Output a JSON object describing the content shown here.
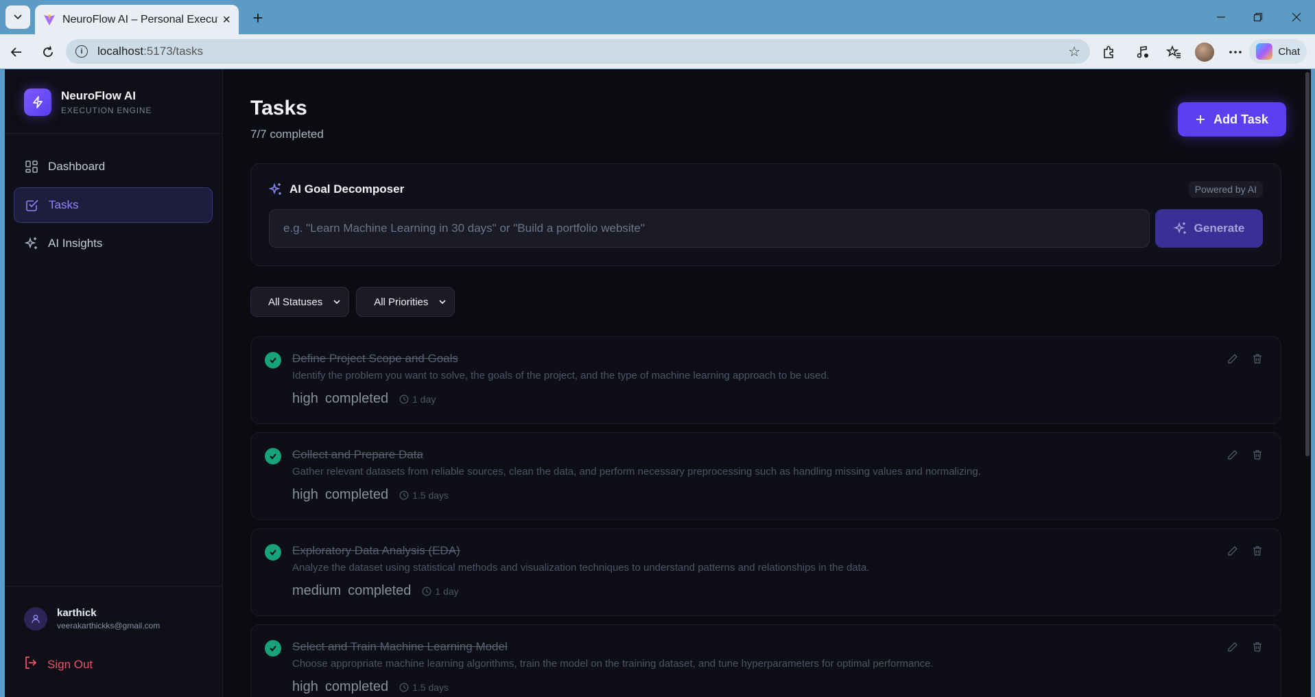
{
  "browser": {
    "tab_title": "NeuroFlow AI – Personal Execution Engine",
    "url_host": "localhost",
    "url_path": ":5173/tasks",
    "chat_label": "Chat"
  },
  "colors": {
    "accent": "#5b3ff0",
    "success": "#16a37a",
    "danger": "#f0506a",
    "background": "#0b0c12"
  },
  "brand": {
    "name": "NeuroFlow AI",
    "subtitle": "EXECUTION ENGINE"
  },
  "sidebar": {
    "items": [
      {
        "label": "Dashboard",
        "icon": "grid-icon"
      },
      {
        "label": "Tasks",
        "icon": "checkbox-icon",
        "active": true
      },
      {
        "label": "AI Insights",
        "icon": "sparkles-icon"
      }
    ]
  },
  "user": {
    "name": "karthick",
    "email": "veerakarthickks@gmail.com",
    "signout_label": "Sign Out"
  },
  "header": {
    "title": "Tasks",
    "subtitle": "7/7 completed",
    "add_task_label": "Add Task"
  },
  "ai_decomposer": {
    "title": "AI Goal Decomposer",
    "badge": "Powered by AI",
    "placeholder": "e.g. \"Learn Machine Learning in 30 days\" or \"Build a portfolio website\"",
    "generate_label": "Generate"
  },
  "filters": {
    "status": "All Statuses",
    "priority": "All Priorities"
  },
  "tasks": [
    {
      "title": "Define Project Scope and Goals",
      "description": "Identify the problem you want to solve, the goals of the project, and the type of machine learning approach to be used.",
      "priority": "high",
      "status": "completed",
      "duration": "1 day"
    },
    {
      "title": "Collect and Prepare Data",
      "description": "Gather relevant datasets from reliable sources, clean the data, and perform necessary preprocessing such as handling missing values and normalizing.",
      "priority": "high",
      "status": "completed",
      "duration": "1.5 days"
    },
    {
      "title": "Exploratory Data Analysis (EDA)",
      "description": "Analyze the dataset using statistical methods and visualization techniques to understand patterns and relationships in the data.",
      "priority": "medium",
      "status": "completed",
      "duration": "1 day"
    },
    {
      "title": "Select and Train Machine Learning Model",
      "description": "Choose appropriate machine learning algorithms, train the model on the training dataset, and tune hyperparameters for optimal performance.",
      "priority": "high",
      "status": "completed",
      "duration": "1.5 days"
    }
  ]
}
